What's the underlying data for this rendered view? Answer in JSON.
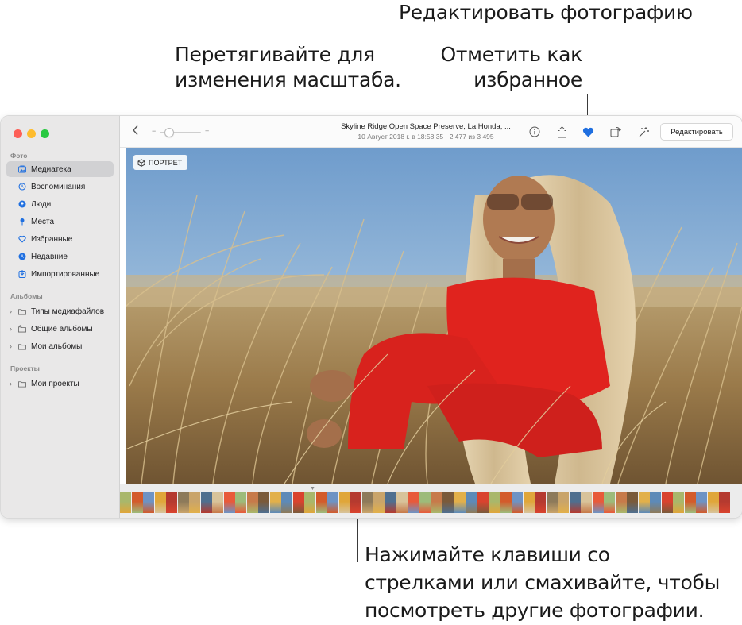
{
  "callouts": {
    "edit_photo": "Редактировать фотографию",
    "zoom_line1": "Перетягивайте для",
    "zoom_line2": "изменения масштаба.",
    "favorite_line1": "Отметить как",
    "favorite_line2": "избранное",
    "arrows_line1": "Нажимайте клавиши со",
    "arrows_line2": "стрелками или смахивайте, чтобы",
    "arrows_line3": "посмотреть другие фотографии."
  },
  "sidebar": {
    "section_photos": "Фото",
    "items": [
      {
        "label": "Медиатека",
        "icon": "library-icon"
      },
      {
        "label": "Воспоминания",
        "icon": "memories-icon"
      },
      {
        "label": "Люди",
        "icon": "people-icon"
      },
      {
        "label": "Места",
        "icon": "places-icon"
      },
      {
        "label": "Избранные",
        "icon": "favorites-icon"
      },
      {
        "label": "Недавние",
        "icon": "recents-icon"
      },
      {
        "label": "Импортированные",
        "icon": "imports-icon"
      }
    ],
    "section_albums": "Альбомы",
    "albums": [
      {
        "label": "Типы медиафайлов",
        "icon": "folder-icon"
      },
      {
        "label": "Общие альбомы",
        "icon": "shared-albums-icon"
      },
      {
        "label": "Мои альбомы",
        "icon": "folder-icon"
      }
    ],
    "section_projects": "Проекты",
    "projects": [
      {
        "label": "Мои проекты",
        "icon": "folder-icon"
      }
    ]
  },
  "toolbar": {
    "title": "Skyline Ridge Open Space Preserve, La Honda, ...",
    "subtitle": "10 Август 2018 г. в 18:58:35  ·  2 477 из 3 495",
    "zoom_minus": "−",
    "zoom_plus": "+",
    "zoom_level": 0.2,
    "edit_label": "Редактировать",
    "favorite_active": true
  },
  "photo": {
    "badge_label": "ПОРТРЕТ"
  },
  "colors": {
    "favorite_blue": "#1f6fe0",
    "sidebar_bg": "#e9e8e8",
    "selection_bg": "#d1d1d3",
    "icon_blue": "#1f6fe0"
  }
}
